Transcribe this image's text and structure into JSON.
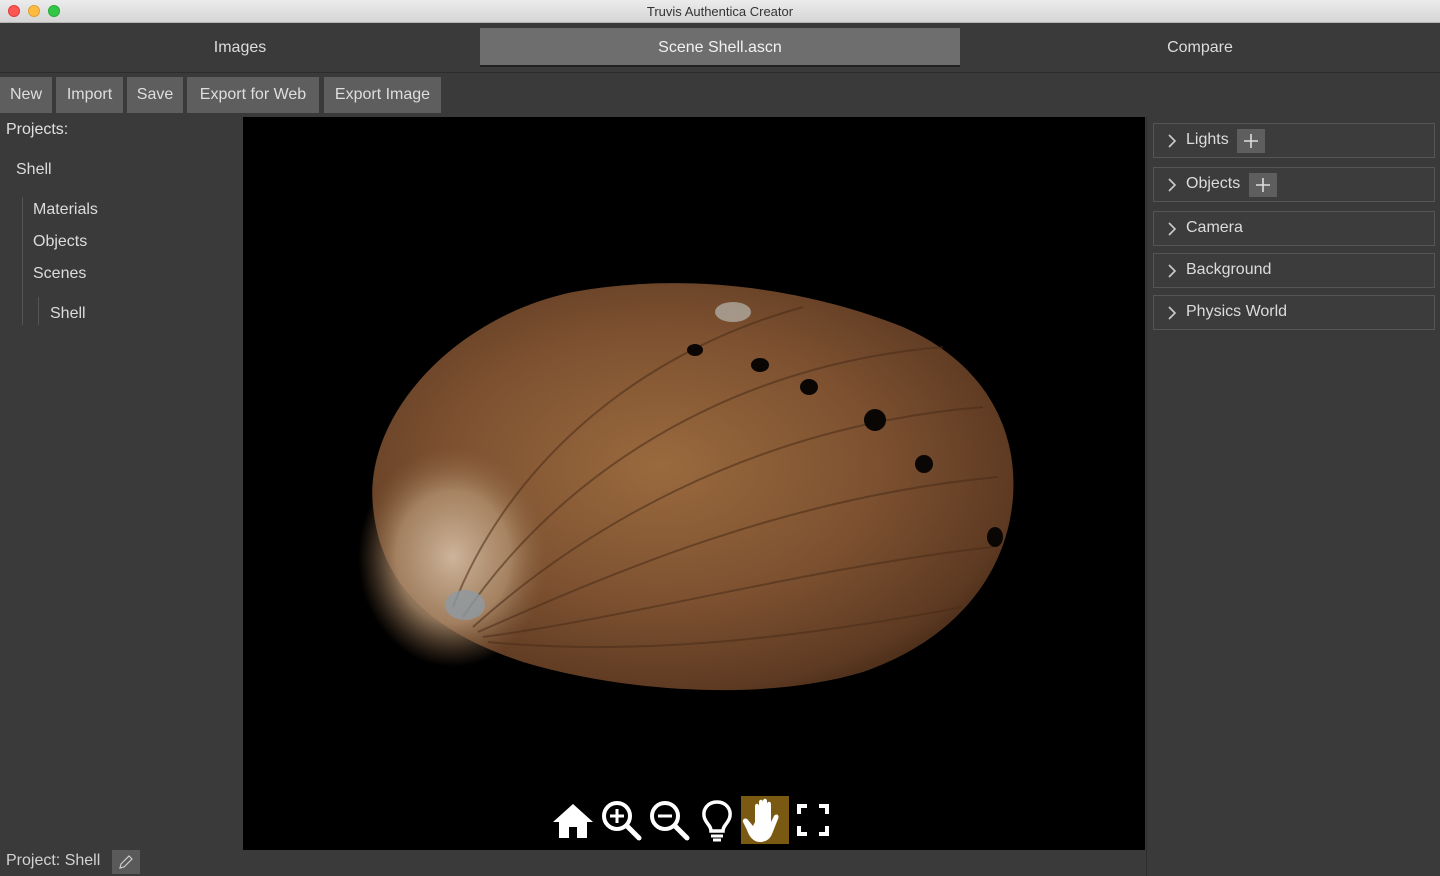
{
  "window": {
    "title": "Truvis Authentica Creator"
  },
  "tabs": [
    {
      "label": "Images"
    },
    {
      "label": "Scene Shell.ascn"
    },
    {
      "label": "Compare"
    }
  ],
  "toolbar": {
    "new_label": "New",
    "import_label": "Import",
    "save_label": "Save",
    "export_web_label": "Export for Web",
    "export_image_label": "Export Image"
  },
  "sidebar": {
    "projects_label": "Projects:",
    "project_name": "Shell",
    "items": [
      {
        "label": "Materials"
      },
      {
        "label": "Objects"
      },
      {
        "label": "Scenes"
      }
    ],
    "scene_child": "Shell"
  },
  "viewer_tools": {
    "icons": [
      "home-icon",
      "zoom-in-icon",
      "zoom-out-icon",
      "lightbulb-icon",
      "hand-pan-icon",
      "fullscreen-icon"
    ],
    "active": "hand-pan-icon",
    "active_color": "#7a5a12"
  },
  "panels": [
    {
      "label": "Lights",
      "has_add": true
    },
    {
      "label": "Objects",
      "has_add": true
    },
    {
      "label": "Camera",
      "has_add": false
    },
    {
      "label": "Background",
      "has_add": false
    },
    {
      "label": "Physics World",
      "has_add": false
    }
  ],
  "status": {
    "project_label": "Project: Shell"
  }
}
